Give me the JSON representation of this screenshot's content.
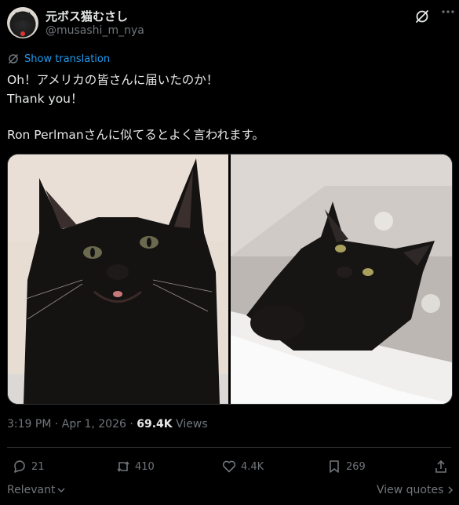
{
  "author": {
    "display_name": "元ボス猫むさし",
    "handle": "@musashi_m_nya"
  },
  "translate_label": "Show translation",
  "tweet_lines": [
    "Oh！アメリカの皆さんに届いたのか！",
    "Thank you！",
    "",
    "Ron Perlmanさんに似てるとよく言われます。"
  ],
  "meta": {
    "time": "3:19 PM",
    "date": "Apr 1, 2026",
    "views_count": "69.4K",
    "views_label": "Views",
    "separator": " · "
  },
  "actions": {
    "replies": "21",
    "reposts": "410",
    "likes": "4.4K",
    "bookmarks": "269"
  },
  "footer": {
    "sort_label": "Relevant",
    "view_quotes_label": "View quotes"
  },
  "colors": {
    "accent": "#1d9bf0",
    "muted": "#71767b",
    "text": "#e7e9ea",
    "background": "#000000",
    "border": "#2f3336"
  }
}
